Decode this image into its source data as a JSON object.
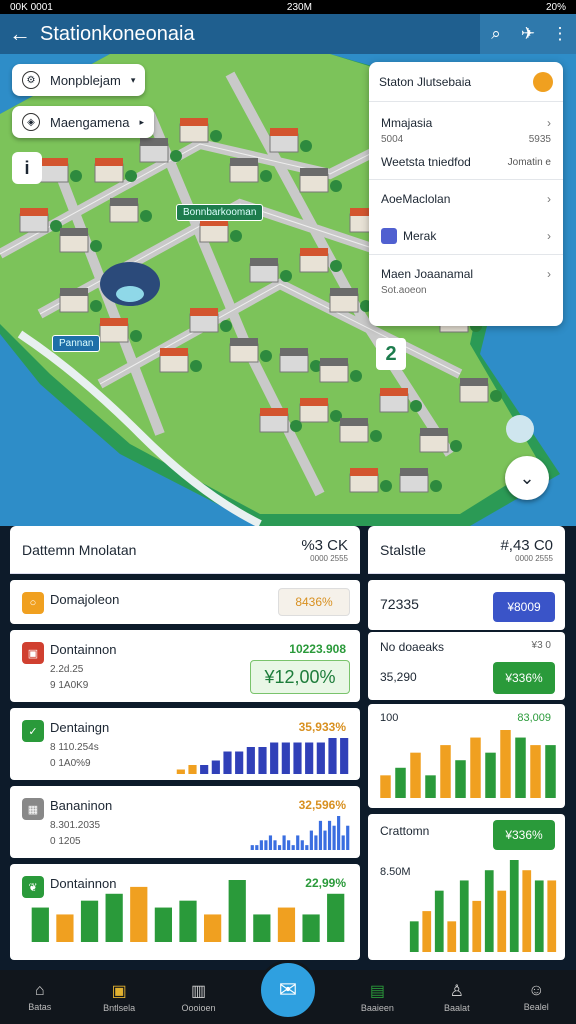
{
  "status_bar": {
    "left": "00K 0001",
    "center": "230M",
    "right": "20%"
  },
  "app_bar": {
    "title": "Stationkoneonaia"
  },
  "map": {
    "pill_1": "Monpblejam",
    "pill_2": "Maengamena",
    "label_green": "Bonnbarkooman",
    "label_small": "Pannan",
    "number_marker": "2"
  },
  "side_card": {
    "header": "Staton Jlutsebaia",
    "row1": "Mmajasia",
    "row1_sub_left": "5004",
    "row1_sub_right": "5935",
    "row2": "Weetsta tniedfod",
    "row2_right": "Jomatin e",
    "row3": "AoeMaclolan",
    "row4": "Merak",
    "row5": "Maen Joaanamal",
    "row5_sub": "Sot.aoeon"
  },
  "left_panel": {
    "header": "Dattemn Mnolatan",
    "header_right": "%3 CK",
    "header_right_sub": "0000 2555",
    "cards": [
      {
        "label": "Domajoleon",
        "value": "8436%"
      },
      {
        "label": "Dontainnon",
        "value": "10223.908",
        "sub1": "2.2d.25",
        "sub2": "9 1A0K9",
        "big": "¥12,00%"
      },
      {
        "label": "Dentaingn",
        "value": "35,933%",
        "sub1": "8 110.254s",
        "sub2": "0 1A0%9"
      },
      {
        "label": "Bananinon",
        "value": "32,596%",
        "sub1": "8.301.2035",
        "sub2": "0 1205"
      },
      {
        "label": "Dontainnon",
        "value": "22,99%"
      }
    ]
  },
  "right_panel": {
    "header": "Stalstle",
    "header_right": "#,43 C0",
    "header_right_sub": "0000 2555",
    "c1_value": "72335",
    "c1_badge": "¥8009",
    "c2_label": "No doaeaks",
    "c2_right": "¥3 0",
    "c2_value": "35,290",
    "c2_badge": "¥336%",
    "c3_left": "100",
    "c3_right": "83,009",
    "c4_label": "Crattomn",
    "c4_badge": "¥336%",
    "c4_value": "8.50M"
  },
  "chart_data": [
    {
      "type": "bar",
      "values": [
        1,
        2,
        2,
        3,
        5,
        5,
        6,
        6,
        7,
        7,
        7,
        7,
        7,
        8,
        8
      ],
      "colors": [
        "#f0a020",
        "#3040b8"
      ]
    },
    {
      "type": "bar",
      "values": [
        1,
        1,
        2,
        2,
        3,
        2,
        1,
        3,
        2,
        1,
        3,
        2,
        1,
        4,
        3,
        6,
        4,
        6,
        5,
        7,
        3,
        5
      ]
    },
    {
      "type": "bar",
      "values": [
        5,
        4,
        6,
        7,
        8,
        5,
        6,
        4,
        9,
        4,
        5,
        4,
        7
      ]
    },
    {
      "type": "bar",
      "values": [
        3,
        4,
        6,
        3,
        7,
        5,
        8,
        6,
        9,
        8,
        7,
        7
      ]
    }
  ],
  "nav": [
    "Batas",
    "Bntlsela",
    "Oooioen",
    "Baaieen",
    "Baalat",
    "Bealel"
  ]
}
